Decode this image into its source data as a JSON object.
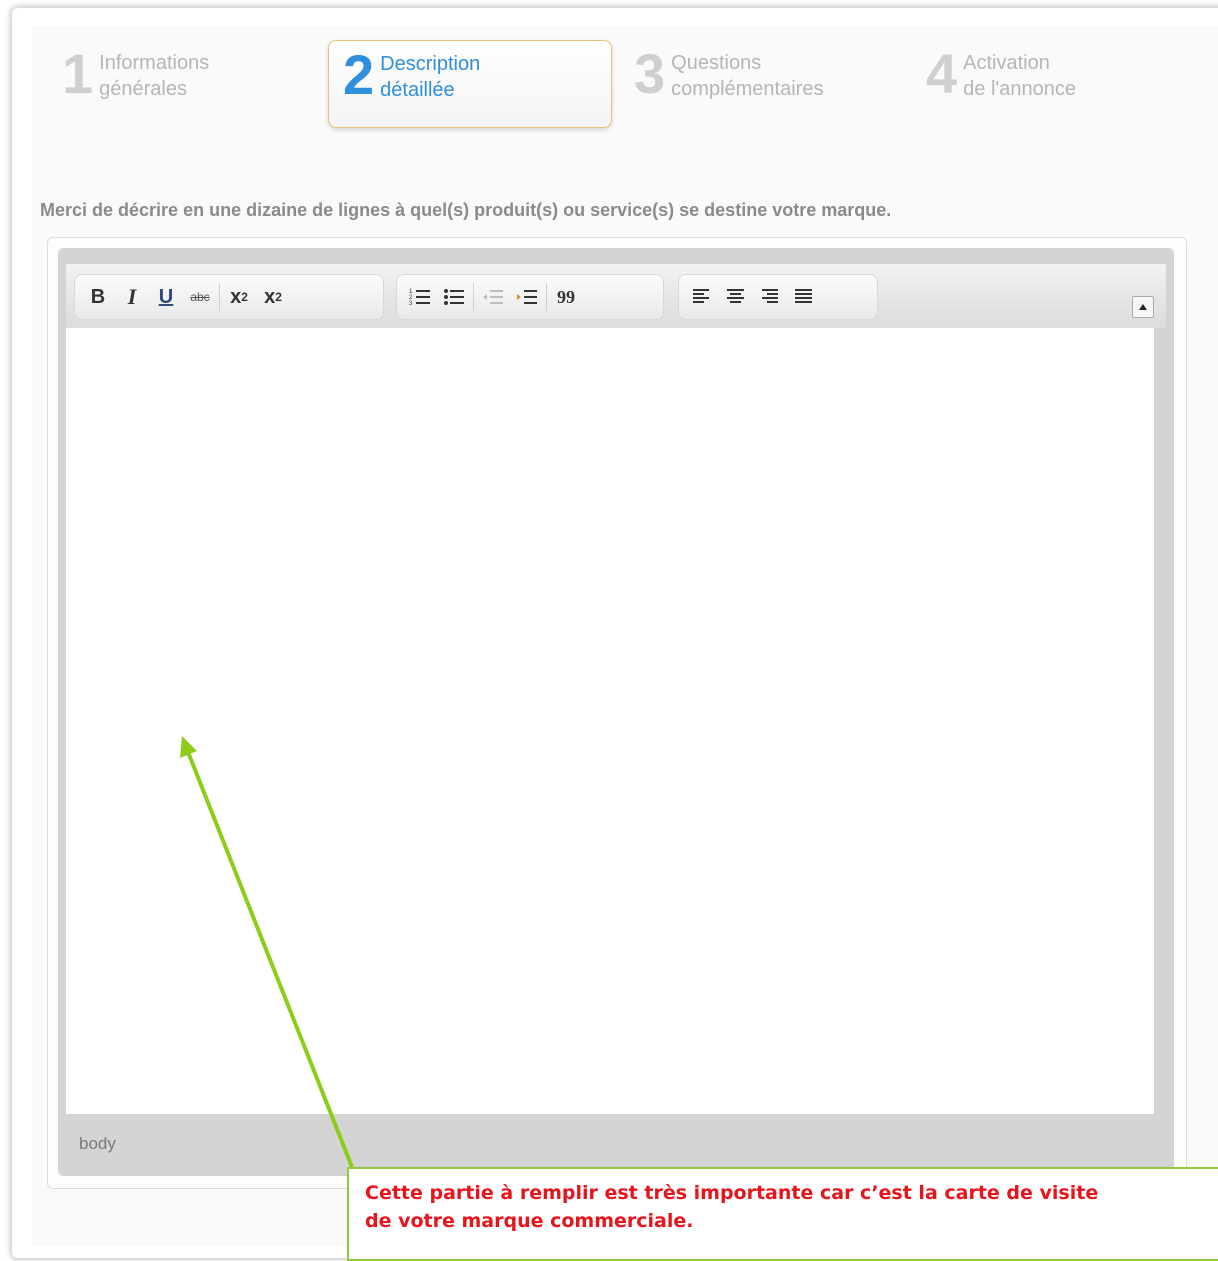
{
  "steps": [
    {
      "num": "1",
      "line1": "Informations",
      "line2": "générales",
      "active": false
    },
    {
      "num": "2",
      "line1": "Description",
      "line2": "détaillée",
      "active": true
    },
    {
      "num": "3",
      "line1": "Questions",
      "line2": "complémentaires",
      "active": false
    },
    {
      "num": "4",
      "line1": "Activation",
      "line2": "de l'annonce",
      "active": false
    }
  ],
  "instruction": "Merci de décrire en une dizaine de lignes à quel(s) produit(s) ou service(s) se destine votre marque.",
  "toolbar": {
    "bold": "B",
    "italic": "I",
    "underline": "U",
    "strike": "abc",
    "subscript_base": "x",
    "subscript_sub": "2",
    "superscript_base": "x",
    "superscript_sup": "2",
    "quote": "99"
  },
  "editor": {
    "path_label": "body"
  },
  "annotation": {
    "text": "Cette partie à remplir est très importante car c’est la carte de visite\nde votre marque commerciale.",
    "text_color": "#e8141c",
    "arrow_color": "#8ccd1a"
  },
  "colors": {
    "active_step": "#2f8fdc",
    "inactive_step": "#b5b5b5"
  }
}
